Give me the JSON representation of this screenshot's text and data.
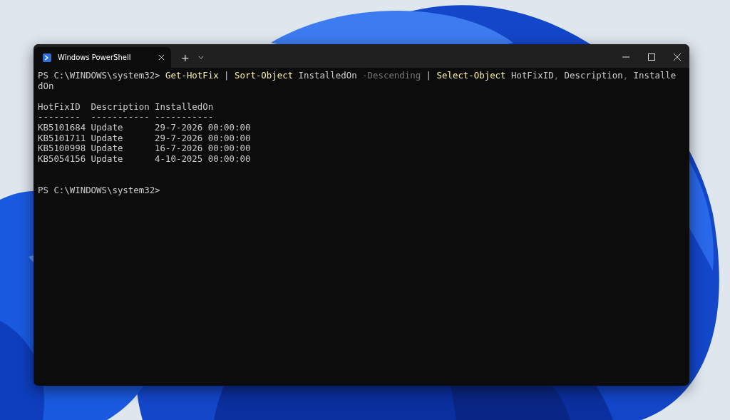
{
  "window": {
    "tabs": [
      {
        "title": "Windows PowerShell",
        "selected": true
      }
    ],
    "new_tab": "+"
  },
  "terminal": {
    "command_lines": [
      {
        "segments": [
          {
            "kind": "prompt",
            "text": "PS C:\\WINDOWS\\system32> "
          },
          {
            "kind": "command",
            "text": "Get-HotFix"
          },
          {
            "kind": "plain",
            "text": " | "
          },
          {
            "kind": "command",
            "text": "Sort-Object"
          },
          {
            "kind": "plain",
            "text": " InstalledOn "
          },
          {
            "kind": "param",
            "text": "-Descending"
          },
          {
            "kind": "plain",
            "text": " | "
          },
          {
            "kind": "command",
            "text": "Select-Object"
          },
          {
            "kind": "plain",
            "text": " HotFixID"
          },
          {
            "kind": "param",
            "text": ","
          },
          {
            "kind": "plain",
            "text": " Description"
          },
          {
            "kind": "param",
            "text": ","
          },
          {
            "kind": "plain",
            "text": " Installe"
          }
        ]
      },
      {
        "segments": [
          {
            "kind": "plain",
            "text": "dOn"
          }
        ]
      }
    ],
    "output_lines": [
      "HotFixID  Description InstalledOn",
      "--------  ----------- -----------",
      "KB5101684 Update      29-7-2026 00:00:00",
      "KB5101711 Update      29-7-2026 00:00:00",
      "KB5100998 Update      16-7-2026 00:00:00",
      "KB5054156 Update      4-10-2025 00:00:00"
    ],
    "prompt": "PS C:\\WINDOWS\\system32>"
  }
}
